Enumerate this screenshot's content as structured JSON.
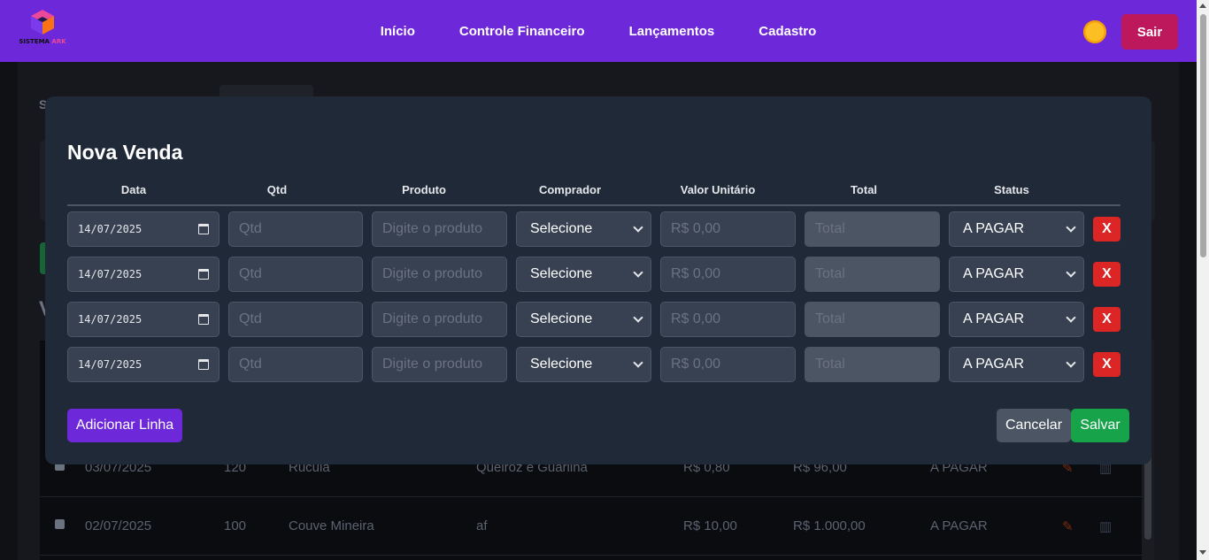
{
  "navbar": {
    "logo_text_main": "SISTEMA",
    "logo_text_accent": "ARK",
    "links": [
      "Início",
      "Controle Financeiro",
      "Lançamentos",
      "Cadastro"
    ],
    "theme_icon": "sun-icon",
    "logout_label": "Sair",
    "accent_color": "#6d28d9"
  },
  "background": {
    "rows": [
      {
        "date": "03/07/2025",
        "qtd": "120",
        "produto": "Rucula",
        "comprador": "Queiroz e Guarilha",
        "valor": "R$ 0,80",
        "total": "R$ 96,00",
        "status": "A PAGAR"
      },
      {
        "date": "02/07/2025",
        "qtd": "100",
        "produto": "Couve Mineira",
        "comprador": "af",
        "valor": "R$ 10,00",
        "total": "R$ 1.000,00",
        "status": "A PAGAR"
      }
    ]
  },
  "modal": {
    "title": "Nova Venda",
    "headers": [
      "Data",
      "Qtd",
      "Produto",
      "Comprador",
      "Valor Unitário",
      "Total",
      "Status"
    ],
    "rows": [
      {
        "date": "14/07/2025",
        "qtd_placeholder": "Qtd",
        "produto_placeholder": "Digite o produto",
        "comprador": "Selecione",
        "valor_placeholder": "R$ 0,00",
        "total_placeholder": "Total",
        "status": "A PAGAR",
        "delete_label": "X"
      },
      {
        "date": "14/07/2025",
        "qtd_placeholder": "Qtd",
        "produto_placeholder": "Digite o produto",
        "comprador": "Selecione",
        "valor_placeholder": "R$ 0,00",
        "total_placeholder": "Total",
        "status": "A PAGAR",
        "delete_label": "X"
      },
      {
        "date": "14/07/2025",
        "qtd_placeholder": "Qtd",
        "produto_placeholder": "Digite o produto",
        "comprador": "Selecione",
        "valor_placeholder": "R$ 0,00",
        "total_placeholder": "Total",
        "status": "A PAGAR",
        "delete_label": "X"
      },
      {
        "date": "14/07/2025",
        "qtd_placeholder": "Qtd",
        "produto_placeholder": "Digite o produto",
        "comprador": "Selecione",
        "valor_placeholder": "R$ 0,00",
        "total_placeholder": "Total",
        "status": "A PAGAR",
        "delete_label": "X"
      }
    ],
    "add_row_label": "Adicionar Linha",
    "cancel_label": "Cancelar",
    "save_label": "Salvar"
  }
}
